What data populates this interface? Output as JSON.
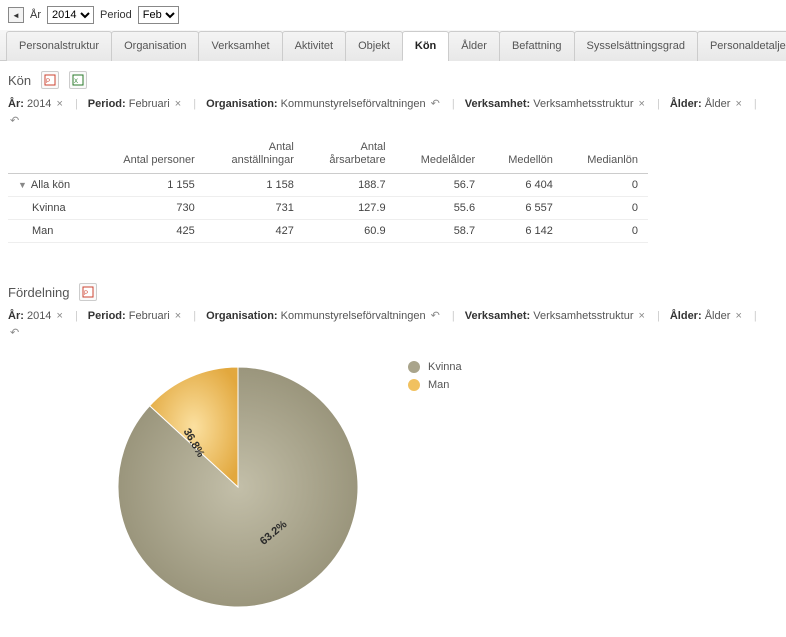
{
  "topbar": {
    "year_label": "År",
    "year_value": "2014",
    "period_label": "Period",
    "period_value": "Feb"
  },
  "tabs": [
    {
      "label": "Personalstruktur",
      "active": false
    },
    {
      "label": "Organisation",
      "active": false
    },
    {
      "label": "Verksamhet",
      "active": false
    },
    {
      "label": "Aktivitet",
      "active": false
    },
    {
      "label": "Objekt",
      "active": false
    },
    {
      "label": "Kön",
      "active": true
    },
    {
      "label": "Ålder",
      "active": false
    },
    {
      "label": "Befattning",
      "active": false
    },
    {
      "label": "Sysselsättningsgrad",
      "active": false
    },
    {
      "label": "Personaldetaljer",
      "active": false
    }
  ],
  "section1": {
    "title": "Kön",
    "crumbs": {
      "ar_label": "År:",
      "ar_value": "2014",
      "period_label": "Period:",
      "period_value": "Februari",
      "org_label": "Organisation:",
      "org_value": "Kommunstyrelseförvaltningen",
      "verk_label": "Verksamhet:",
      "verk_value": "Verksamhetsstruktur",
      "alder_label": "Ålder:",
      "alder_value": "Ålder"
    },
    "headers": [
      "",
      "Antal personer",
      "Antal anställningar",
      "Antal årsarbetare",
      "Medelålder",
      "Medellön",
      "Medianlön"
    ],
    "rows": [
      {
        "label": "Alla kön",
        "expandable": true,
        "c1": "1 155",
        "c2": "1 158",
        "c3": "188.7",
        "c4": "56.7",
        "c5": "6 404",
        "c6": "0"
      },
      {
        "label": "Kvinna",
        "expandable": false,
        "c1": "730",
        "c2": "731",
        "c3": "127.9",
        "c4": "55.6",
        "c5": "6 557",
        "c6": "0"
      },
      {
        "label": "Man",
        "expandable": false,
        "c1": "425",
        "c2": "427",
        "c3": "60.9",
        "c4": "58.7",
        "c5": "6 142",
        "c6": "0"
      }
    ]
  },
  "section2": {
    "title": "Fördelning",
    "crumbs": {
      "ar_label": "År:",
      "ar_value": "2014",
      "period_label": "Period:",
      "period_value": "Februari",
      "org_label": "Organisation:",
      "org_value": "Kommunstyrelseförvaltningen",
      "verk_label": "Verksamhet:",
      "verk_value": "Verksamhetsstruktur",
      "alder_label": "Ålder:",
      "alder_value": "Ålder"
    }
  },
  "chart_data": {
    "type": "pie",
    "title": "Fördelning",
    "series": [
      {
        "name": "Kvinna",
        "value": 63.2,
        "color": "#a9a48b",
        "label": "63.2%"
      },
      {
        "name": "Man",
        "value": 36.8,
        "color": "#f1c15f",
        "label": "36.8%"
      }
    ]
  }
}
